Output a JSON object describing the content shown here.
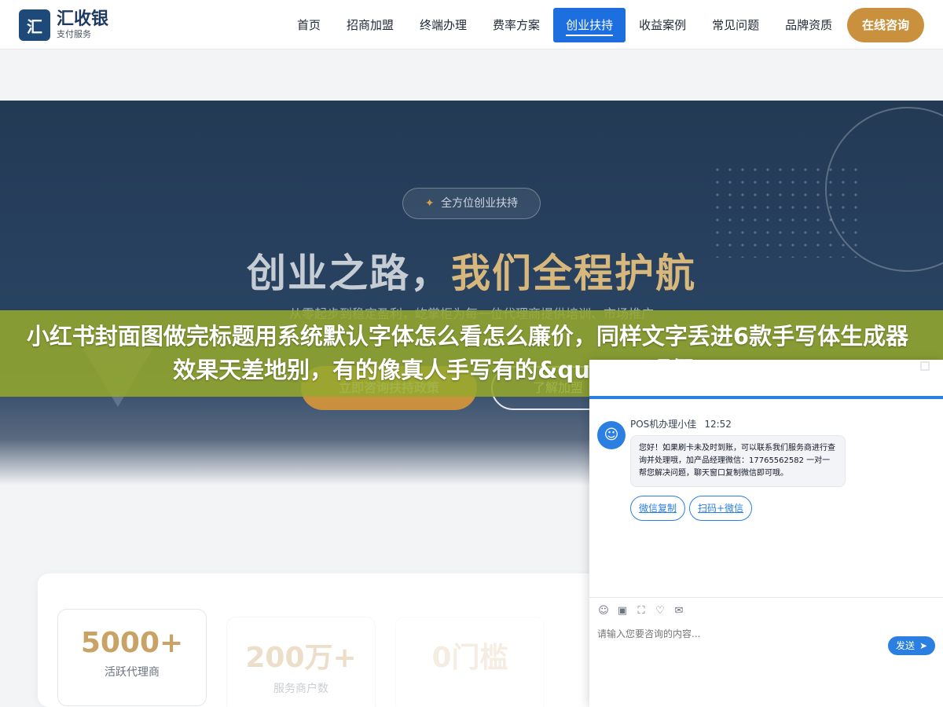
{
  "header": {
    "logo_mark": "汇",
    "logo_name": "汇收银",
    "logo_sub": "支付服务",
    "nav": [
      "首页",
      "招商加盟",
      "终端办理",
      "费率方案",
      "创业扶持",
      "收益案例",
      "常见问题",
      "品牌资质"
    ],
    "active_nav": "创业扶持",
    "consult_label": "在线咨询"
  },
  "hero": {
    "badge": "全方位创业扶持",
    "title_main": "创业之路，",
    "title_highlight": "我们全程护航",
    "description": "从零起步到稳定盈利，屹掌柜为每一位代理商提供培训、市场推广",
    "cta_primary": "立即咨询扶持政策",
    "cta_secondary": "了解加盟"
  },
  "banner": {
    "text": "小红书封面图做完标题用系统默认字体怎么看怎么廉价，同样文字丢进6款手写体生成器效果天差地别，有的像真人手写有的&quot;一眼假&quo"
  },
  "stats": [
    {
      "value": "5000+",
      "label": "活跃代理商"
    },
    {
      "value": "200万+",
      "label": "服务商户数"
    },
    {
      "value": "0门槛",
      "label": ""
    }
  ],
  "chat": {
    "agent_name": "POS机办理小佳",
    "time": "12:52",
    "message": "您好！如果刷卡未及时到账，可以联系我们服务商进行查询并处理哦，加产品经理微信：17765562582 一对一帮您解决问题，聊天窗口复制微信即可哦。",
    "chip_copy": "微信复制",
    "chip_scan": "扫码+微信",
    "input_placeholder": "请输入您要咨询的内容...",
    "send_label": "发送"
  },
  "colors": {
    "brand_blue": "#1d6fe0",
    "gold": "#c9913e",
    "banner_green": "#94a72e",
    "hero_navy": "#233a55"
  }
}
